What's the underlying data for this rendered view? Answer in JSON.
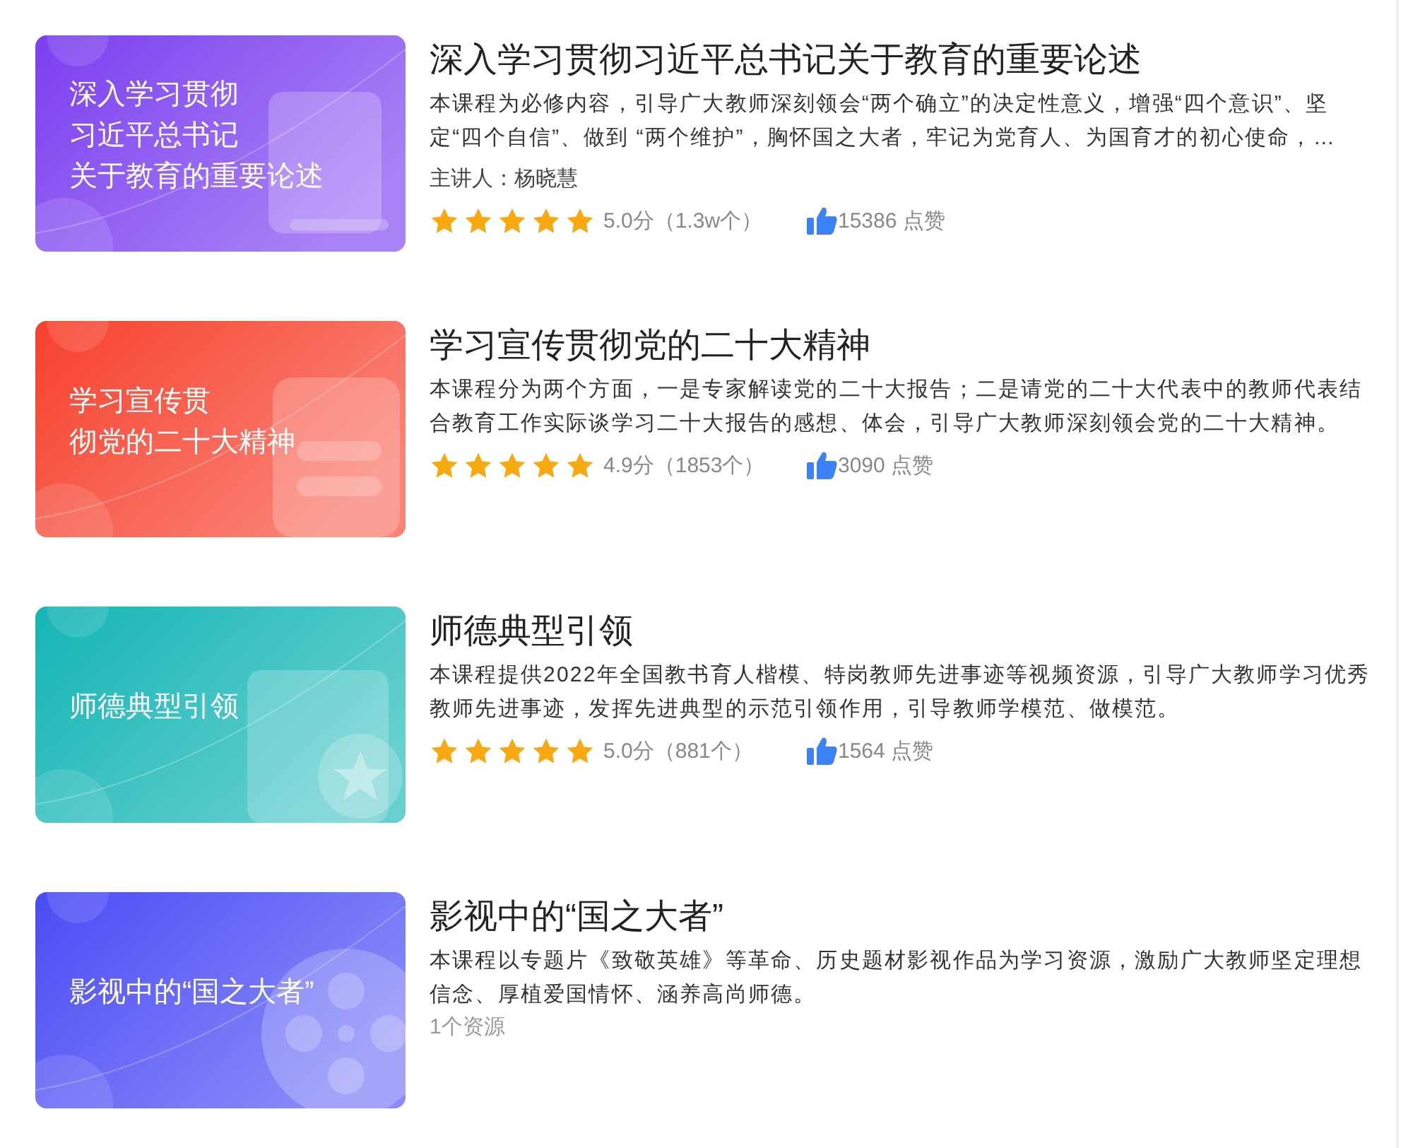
{
  "courses": [
    {
      "kind": "rated",
      "cover": {
        "lines": [
          "深入学习贯彻",
          "习近平总书记",
          "关于教育的重要论述"
        ],
        "color": "#7b3ff0",
        "kind": "book"
      },
      "title": "深入学习贯彻习近平总书记关于教育的重要论述",
      "description": "本课程为必修内容，引导广大教师深刻领会“两个确立”的决定性意义，增强“四个意识”、坚定“四个自信”、做到 “两个维护”，胸怀国之大者，牢记为党育人、为国育才的初心使命，…",
      "lecturer": "主讲人：杨晓慧",
      "stars": 5,
      "score": "5.0分（1.3w个）",
      "likes": "15386 点赞"
    },
    {
      "kind": "rated",
      "cover": {
        "lines": [
          "学习宣传贯",
          "彻党的二十大精神"
        ],
        "color": "#f7412d",
        "kind": "document"
      },
      "title": "学习宣传贯彻党的二十大精神",
      "description": "本课程分为两个方面，一是专家解读党的二十大报告；二是请党的二十大代表中的教师代表结合教育工作实际谈学习二十大报告的感想、体会，引导广大教师深刻领会党的二十大精神。",
      "stars": 5,
      "score": "4.9分（1853个）",
      "likes": "3090 点赞"
    },
    {
      "kind": "rated",
      "cover": {
        "lines": [
          "师德典型引领"
        ],
        "color": "#14b5b5",
        "kind": "badge"
      },
      "title": "师德典型引领",
      "description": "本课程提供2022年全国教书育人楷模、特岗教师先进事迹等视频资源，引导广大教师学习优秀教师先进事迹，发挥先进典型的示范引领作用，引导教师学模范、做模范。",
      "stars": 5,
      "score": "5.0分（881个）",
      "likes": "1564 点赞"
    },
    {
      "kind": "resource",
      "cover": {
        "lines": [
          "影视中的“国之大者”"
        ],
        "color": "#4a4cf5",
        "kind": "film"
      },
      "title": "影视中的“国之大者”",
      "description": "本课程以专题片《致敬英雄》等革命、历史题材影视作品为学习资源，激励广大教师坚定理想信念、厚植爱国情怀、涵养高尚师德。",
      "resources": "1个资源"
    }
  ]
}
